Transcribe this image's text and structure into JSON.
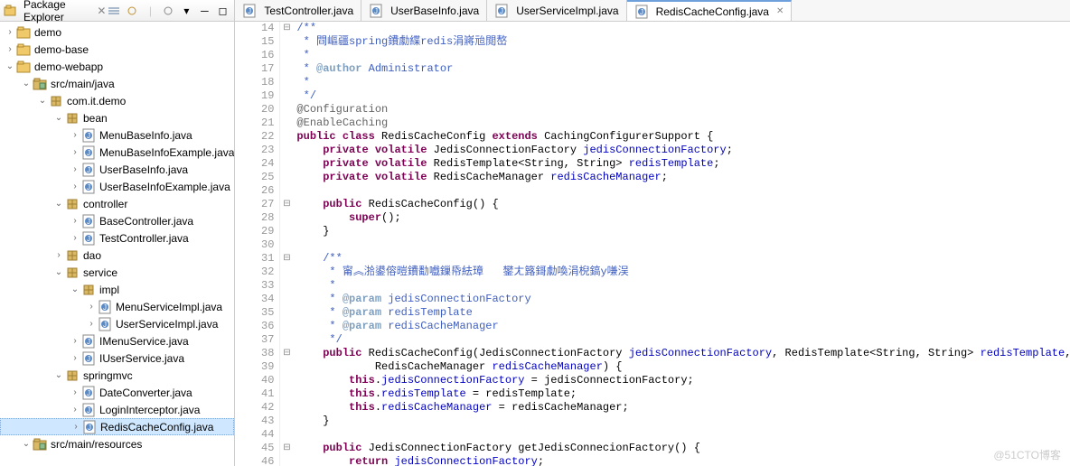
{
  "pkgExplorer": {
    "title": "Package Explorer",
    "toolbarIcons": [
      "collapse",
      "link",
      "view-menu",
      "min",
      "max"
    ]
  },
  "tree": [
    {
      "d": 0,
      "tw": ">",
      "icon": "project",
      "label": "demo"
    },
    {
      "d": 0,
      "tw": ">",
      "icon": "project",
      "label": "demo-base"
    },
    {
      "d": 0,
      "tw": "v",
      "icon": "project",
      "label": "demo-webapp"
    },
    {
      "d": 1,
      "tw": "v",
      "icon": "source-folder",
      "label": "src/main/java"
    },
    {
      "d": 2,
      "tw": "v",
      "icon": "package",
      "label": "com.it.demo"
    },
    {
      "d": 3,
      "tw": "v",
      "icon": "package",
      "label": "bean"
    },
    {
      "d": 4,
      "tw": ">",
      "icon": "java",
      "label": "MenuBaseInfo.java"
    },
    {
      "d": 4,
      "tw": ">",
      "icon": "java",
      "label": "MenuBaseInfoExample.java"
    },
    {
      "d": 4,
      "tw": ">",
      "icon": "java",
      "label": "UserBaseInfo.java"
    },
    {
      "d": 4,
      "tw": ">",
      "icon": "java",
      "label": "UserBaseInfoExample.java"
    },
    {
      "d": 3,
      "tw": "v",
      "icon": "package",
      "label": "controller"
    },
    {
      "d": 4,
      "tw": ">",
      "icon": "java",
      "label": "BaseController.java"
    },
    {
      "d": 4,
      "tw": ">",
      "icon": "java",
      "label": "TestController.java"
    },
    {
      "d": 3,
      "tw": ">",
      "icon": "package",
      "label": "dao"
    },
    {
      "d": 3,
      "tw": "v",
      "icon": "package",
      "label": "service"
    },
    {
      "d": 4,
      "tw": "v",
      "icon": "package",
      "label": "impl"
    },
    {
      "d": 5,
      "tw": ">",
      "icon": "java",
      "label": "MenuServiceImpl.java"
    },
    {
      "d": 5,
      "tw": ">",
      "icon": "java",
      "label": "UserServiceImpl.java"
    },
    {
      "d": 4,
      "tw": ">",
      "icon": "java",
      "label": "IMenuService.java"
    },
    {
      "d": 4,
      "tw": ">",
      "icon": "java",
      "label": "IUserService.java"
    },
    {
      "d": 3,
      "tw": "v",
      "icon": "package",
      "label": "springmvc"
    },
    {
      "d": 4,
      "tw": ">",
      "icon": "java",
      "label": "DateConverter.java"
    },
    {
      "d": 4,
      "tw": ">",
      "icon": "java",
      "label": "LoginInterceptor.java"
    },
    {
      "d": 4,
      "tw": ">",
      "icon": "java",
      "label": "RedisCacheConfig.java",
      "sel": true
    },
    {
      "d": 1,
      "tw": "v",
      "icon": "source-folder",
      "label": "src/main/resources"
    }
  ],
  "tabs": [
    {
      "icon": "java",
      "label": "TestController.java"
    },
    {
      "icon": "java",
      "label": "UserBaseInfo.java"
    },
    {
      "icon": "java",
      "label": "UserServiceImpl.java"
    },
    {
      "icon": "java",
      "label": "RedisCacheConfig.java",
      "active": true
    }
  ],
  "code": {
    "startLine": 14,
    "lines": [
      {
        "n": 14,
        "fold": "-",
        "html": "<span class='jd'>/**</span>"
      },
      {
        "n": 15,
        "html": "<span class='jd'> * 閰嶇疆spring鐨勮緤redis涓嶈兘閲嶅</span>"
      },
      {
        "n": 16,
        "html": "<span class='jd'> *</span>"
      },
      {
        "n": 17,
        "html": "<span class='jd'> * <span class='jdt'>@author</span> Administrator</span>"
      },
      {
        "n": 18,
        "html": "<span class='jd'> *</span>"
      },
      {
        "n": 19,
        "html": "<span class='jd'> */</span>"
      },
      {
        "n": 20,
        "html": "<span class='ann'>@Configuration</span>"
      },
      {
        "n": 21,
        "html": "<span class='ann'>@EnableCaching</span>"
      },
      {
        "n": 22,
        "html": "<span class='kw'>public class</span> RedisCacheConfig <span class='kw'>extends</span> CachingConfigurerSupport {"
      },
      {
        "n": 23,
        "html": "    <span class='kw'>private volatile</span> JedisConnectionFactory <span class='fld'>jedisConnectionFactory</span>;"
      },
      {
        "n": 24,
        "html": "    <span class='kw'>private volatile</span> RedisTemplate&lt;String, String&gt; <span class='fld'>redisTemplate</span>;"
      },
      {
        "n": 25,
        "html": "    <span class='kw'>private volatile</span> RedisCacheManager <span class='fld'>redisCacheManager</span>;"
      },
      {
        "n": 26,
        "html": ""
      },
      {
        "n": 27,
        "fold": "-",
        "html": "    <span class='kw'>public</span> RedisCacheConfig() {"
      },
      {
        "n": 28,
        "html": "        <span class='kw'>super</span>();"
      },
      {
        "n": 29,
        "html": "    }"
      },
      {
        "n": 30,
        "html": ""
      },
      {
        "n": 31,
        "fold": "-",
        "html": "    <span class='jd'>/**</span>"
      },
      {
        "n": 32,
        "html": "    <span class='jd'> * 甯︽湁鍙傛暟鐨勫嚱鏁帋紶璋   鐢ㄤ簬鎶勮喚涓棿鎬у嗛洖</span>"
      },
      {
        "n": 33,
        "html": "    <span class='jd'> *</span>"
      },
      {
        "n": 34,
        "html": "    <span class='jd'> * <span class='jdt'>@param</span> jedisConnectionFactory</span>"
      },
      {
        "n": 35,
        "html": "    <span class='jd'> * <span class='jdt'>@param</span> redisTemplate</span>"
      },
      {
        "n": 36,
        "html": "    <span class='jd'> * <span class='jdt'>@param</span> redisCacheManager</span>"
      },
      {
        "n": 37,
        "html": "    <span class='jd'> */</span>"
      },
      {
        "n": 38,
        "fold": "-",
        "html": "    <span class='kw'>public</span> RedisCacheConfig(JedisConnectionFactory <span class='fld'>jedisConnectionFactory</span>, RedisTemplate&lt;String, String&gt; <span class='fld'>redisTemplate</span>,"
      },
      {
        "n": 39,
        "html": "            RedisCacheManager <span class='fld'>redisCacheManager</span>) {"
      },
      {
        "n": 40,
        "html": "        <span class='kw'>this</span>.<span class='fld'>jedisConnectionFactory</span> = jedisConnectionFactory;"
      },
      {
        "n": 41,
        "html": "        <span class='kw'>this</span>.<span class='fld'>redisTemplate</span> = redisTemplate;"
      },
      {
        "n": 42,
        "html": "        <span class='kw'>this</span>.<span class='fld'>redisCacheManager</span> = redisCacheManager;"
      },
      {
        "n": 43,
        "html": "    }"
      },
      {
        "n": 44,
        "html": ""
      },
      {
        "n": 45,
        "fold": "-",
        "html": "    <span class='kw'>public</span> JedisConnectionFactory getJedisConnecionFactory() {"
      },
      {
        "n": 46,
        "html": "        <span class='kw'>return</span> <span class='fld'>jedisConnectionFactory</span>;"
      }
    ]
  },
  "watermark": "@51CTO博客"
}
